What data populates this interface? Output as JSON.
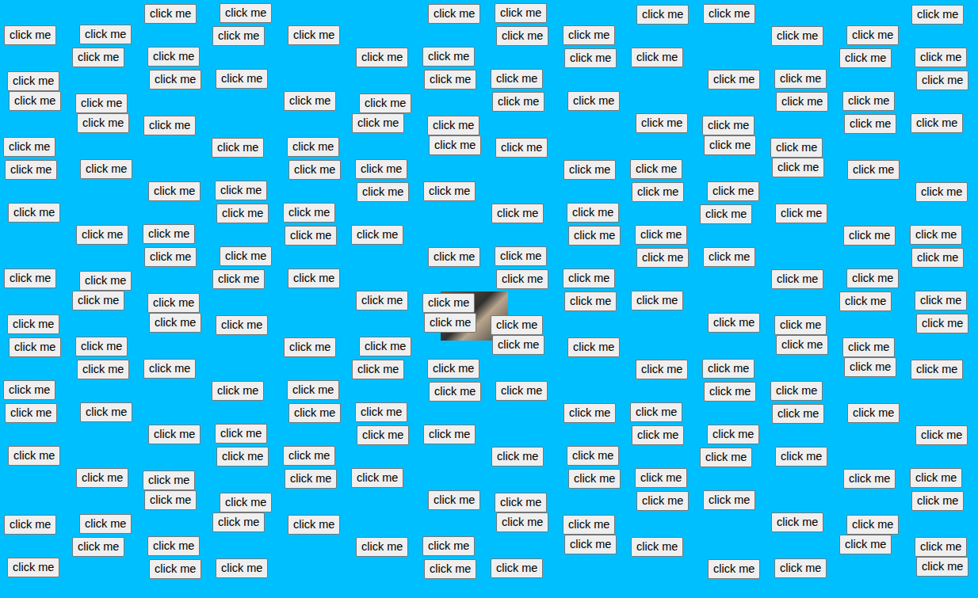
{
  "buttons": [
    "click me",
    "click me",
    "click me",
    "click me",
    "click me",
    "click me",
    "click me",
    "click me",
    "click me",
    "click me",
    "click me",
    "click me",
    "click me",
    "click me",
    "click me",
    "click me",
    "click me",
    "click me",
    "click me",
    "click me",
    "click me",
    "click me",
    "click me",
    "click me",
    "click me",
    "click me",
    "click me",
    "click me",
    "click me",
    "click me",
    "click me",
    "click me",
    "click me",
    "click me",
    "click me",
    "click me",
    "click me",
    "click me",
    "click me",
    "click me",
    "click me",
    "click me",
    "click me",
    "click me",
    "click me",
    "click me",
    "click me",
    "click me",
    "click me",
    "click me",
    "click me",
    "click me",
    "click me",
    "click me",
    "click me",
    "click me",
    "click me",
    "click me",
    "click me",
    "click me",
    "click me",
    "click me",
    "click me",
    "click me",
    "click me",
    "click me",
    "click me",
    "click me",
    "click me",
    "click me",
    "click me",
    "click me",
    "click me",
    "click me",
    "click me",
    "click me",
    "click me",
    "click me",
    "click me",
    "click me",
    "click me",
    "click me",
    "click me",
    "click me",
    "click me",
    "click me",
    "click me",
    "click me",
    "click me",
    "click me",
    "click me",
    "click me",
    "click me",
    "click me",
    "click me",
    "click me",
    "click me",
    "click me",
    "click me",
    "click me",
    "click me",
    "click me",
    "click me",
    "click me",
    "click me",
    "click me",
    "click me",
    "click me",
    "click me",
    "click me",
    "click me",
    "click me",
    "click me",
    "click me",
    "click me",
    "click me",
    "click me",
    "click me",
    "click me",
    "click me",
    "click me",
    "click me",
    "click me",
    "click me",
    "click me",
    "click me",
    "click me",
    "click me",
    "click me",
    "click me",
    "click me",
    "click me",
    "click me",
    "click me",
    "click me",
    "click me",
    "click me",
    "click me",
    "click me",
    "click me",
    "click me",
    "click me",
    "click me",
    "click me",
    "click me",
    "click me",
    "click me",
    "click me",
    "click me",
    "click me",
    "click me",
    "click me",
    "click me",
    "click me",
    "click me",
    "click me",
    "click me",
    "click me",
    "click me",
    "click me",
    "click me",
    "click me",
    "click me",
    "click me",
    "click me",
    "click me",
    "click me",
    "click me",
    "click me",
    "click me",
    "click me",
    "click me",
    "click me",
    "click me",
    "click me",
    "click me",
    "click me",
    "click me",
    "click me",
    "click me",
    "click me",
    "click me",
    "click me",
    "click me",
    "click me",
    "click me",
    "click me",
    "click me",
    "click me",
    "click me",
    "click me",
    "click me",
    "click me",
    "click me",
    "click me",
    "click me",
    "click me",
    "click me",
    "click me",
    "click me"
  ]
}
